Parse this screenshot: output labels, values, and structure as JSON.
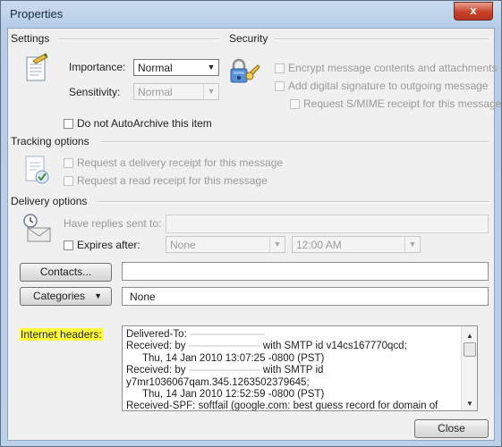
{
  "window": {
    "title": "Properties",
    "close_glyph": "x"
  },
  "settings": {
    "label": "Settings",
    "importance_label": "Importance:",
    "importance_value": "Normal",
    "sensitivity_label": "Sensitivity:",
    "sensitivity_value": "Normal",
    "autoarchive_label": "Do not AutoArchive this item"
  },
  "security": {
    "label": "Security",
    "encrypt_label": "Encrypt message contents and attachments",
    "signature_label": "Add digital signature to outgoing message",
    "smime_label": "Request S/MIME receipt for this message"
  },
  "tracking": {
    "label": "Tracking options",
    "delivery_receipt_label": "Request a delivery receipt for this message",
    "read_receipt_label": "Request a read receipt for this message"
  },
  "delivery": {
    "label": "Delivery options",
    "replies_label": "Have replies sent to:",
    "expires_label": "Expires after:",
    "expires_date": "None",
    "expires_time": "12:00 AM"
  },
  "contacts_button": "Contacts...",
  "categories": {
    "button_label": "Categories",
    "value": "None"
  },
  "internet_headers": {
    "label": "Internet headers:",
    "lines": [
      "Delivered-To:",
      "Received: by",
      "with SMTP id v14cs167770qcd;",
      "Thu, 14 Jan 2010 13:07:25 -0800 (PST)",
      "Received: by",
      "with SMTP id",
      "y7mr1036067qam.345.1263502379645;",
      "Thu, 14 Jan 2010 12:52:59 -0800 (PST)",
      "Received-SPF: softfail (google.com: best guess record for domain of"
    ]
  },
  "close_button": "Close",
  "colors": {
    "highlight": "#ffff3a",
    "titlebar": "#c9dbef",
    "close_red": "#c7412a"
  }
}
